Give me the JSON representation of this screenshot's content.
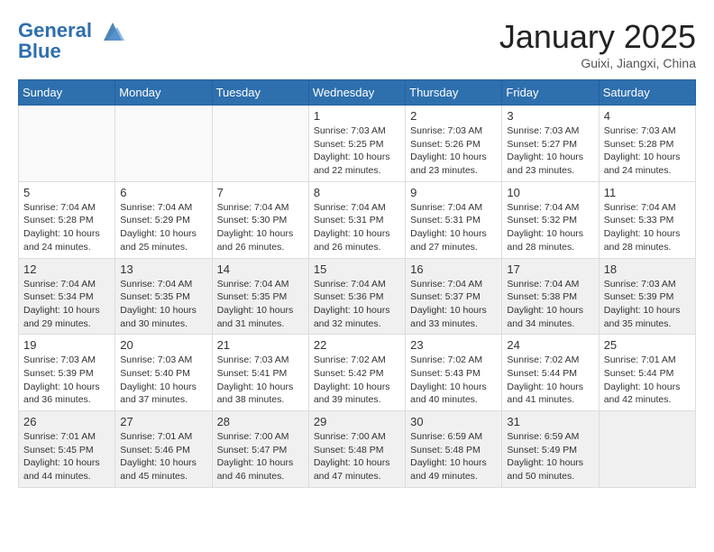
{
  "header": {
    "logo_line1": "General",
    "logo_line2": "Blue",
    "month": "January 2025",
    "location": "Guixi, Jiangxi, China"
  },
  "weekdays": [
    "Sunday",
    "Monday",
    "Tuesday",
    "Wednesday",
    "Thursday",
    "Friday",
    "Saturday"
  ],
  "weeks": [
    {
      "shaded": false,
      "days": [
        {
          "num": "",
          "info": ""
        },
        {
          "num": "",
          "info": ""
        },
        {
          "num": "",
          "info": ""
        },
        {
          "num": "1",
          "info": "Sunrise: 7:03 AM\nSunset: 5:25 PM\nDaylight: 10 hours\nand 22 minutes."
        },
        {
          "num": "2",
          "info": "Sunrise: 7:03 AM\nSunset: 5:26 PM\nDaylight: 10 hours\nand 23 minutes."
        },
        {
          "num": "3",
          "info": "Sunrise: 7:03 AM\nSunset: 5:27 PM\nDaylight: 10 hours\nand 23 minutes."
        },
        {
          "num": "4",
          "info": "Sunrise: 7:03 AM\nSunset: 5:28 PM\nDaylight: 10 hours\nand 24 minutes."
        }
      ]
    },
    {
      "shaded": false,
      "days": [
        {
          "num": "5",
          "info": "Sunrise: 7:04 AM\nSunset: 5:28 PM\nDaylight: 10 hours\nand 24 minutes."
        },
        {
          "num": "6",
          "info": "Sunrise: 7:04 AM\nSunset: 5:29 PM\nDaylight: 10 hours\nand 25 minutes."
        },
        {
          "num": "7",
          "info": "Sunrise: 7:04 AM\nSunset: 5:30 PM\nDaylight: 10 hours\nand 26 minutes."
        },
        {
          "num": "8",
          "info": "Sunrise: 7:04 AM\nSunset: 5:31 PM\nDaylight: 10 hours\nand 26 minutes."
        },
        {
          "num": "9",
          "info": "Sunrise: 7:04 AM\nSunset: 5:31 PM\nDaylight: 10 hours\nand 27 minutes."
        },
        {
          "num": "10",
          "info": "Sunrise: 7:04 AM\nSunset: 5:32 PM\nDaylight: 10 hours\nand 28 minutes."
        },
        {
          "num": "11",
          "info": "Sunrise: 7:04 AM\nSunset: 5:33 PM\nDaylight: 10 hours\nand 28 minutes."
        }
      ]
    },
    {
      "shaded": true,
      "days": [
        {
          "num": "12",
          "info": "Sunrise: 7:04 AM\nSunset: 5:34 PM\nDaylight: 10 hours\nand 29 minutes."
        },
        {
          "num": "13",
          "info": "Sunrise: 7:04 AM\nSunset: 5:35 PM\nDaylight: 10 hours\nand 30 minutes."
        },
        {
          "num": "14",
          "info": "Sunrise: 7:04 AM\nSunset: 5:35 PM\nDaylight: 10 hours\nand 31 minutes."
        },
        {
          "num": "15",
          "info": "Sunrise: 7:04 AM\nSunset: 5:36 PM\nDaylight: 10 hours\nand 32 minutes."
        },
        {
          "num": "16",
          "info": "Sunrise: 7:04 AM\nSunset: 5:37 PM\nDaylight: 10 hours\nand 33 minutes."
        },
        {
          "num": "17",
          "info": "Sunrise: 7:04 AM\nSunset: 5:38 PM\nDaylight: 10 hours\nand 34 minutes."
        },
        {
          "num": "18",
          "info": "Sunrise: 7:03 AM\nSunset: 5:39 PM\nDaylight: 10 hours\nand 35 minutes."
        }
      ]
    },
    {
      "shaded": false,
      "days": [
        {
          "num": "19",
          "info": "Sunrise: 7:03 AM\nSunset: 5:39 PM\nDaylight: 10 hours\nand 36 minutes."
        },
        {
          "num": "20",
          "info": "Sunrise: 7:03 AM\nSunset: 5:40 PM\nDaylight: 10 hours\nand 37 minutes."
        },
        {
          "num": "21",
          "info": "Sunrise: 7:03 AM\nSunset: 5:41 PM\nDaylight: 10 hours\nand 38 minutes."
        },
        {
          "num": "22",
          "info": "Sunrise: 7:02 AM\nSunset: 5:42 PM\nDaylight: 10 hours\nand 39 minutes."
        },
        {
          "num": "23",
          "info": "Sunrise: 7:02 AM\nSunset: 5:43 PM\nDaylight: 10 hours\nand 40 minutes."
        },
        {
          "num": "24",
          "info": "Sunrise: 7:02 AM\nSunset: 5:44 PM\nDaylight: 10 hours\nand 41 minutes."
        },
        {
          "num": "25",
          "info": "Sunrise: 7:01 AM\nSunset: 5:44 PM\nDaylight: 10 hours\nand 42 minutes."
        }
      ]
    },
    {
      "shaded": true,
      "days": [
        {
          "num": "26",
          "info": "Sunrise: 7:01 AM\nSunset: 5:45 PM\nDaylight: 10 hours\nand 44 minutes."
        },
        {
          "num": "27",
          "info": "Sunrise: 7:01 AM\nSunset: 5:46 PM\nDaylight: 10 hours\nand 45 minutes."
        },
        {
          "num": "28",
          "info": "Sunrise: 7:00 AM\nSunset: 5:47 PM\nDaylight: 10 hours\nand 46 minutes."
        },
        {
          "num": "29",
          "info": "Sunrise: 7:00 AM\nSunset: 5:48 PM\nDaylight: 10 hours\nand 47 minutes."
        },
        {
          "num": "30",
          "info": "Sunrise: 6:59 AM\nSunset: 5:48 PM\nDaylight: 10 hours\nand 49 minutes."
        },
        {
          "num": "31",
          "info": "Sunrise: 6:59 AM\nSunset: 5:49 PM\nDaylight: 10 hours\nand 50 minutes."
        },
        {
          "num": "",
          "info": ""
        }
      ]
    }
  ]
}
